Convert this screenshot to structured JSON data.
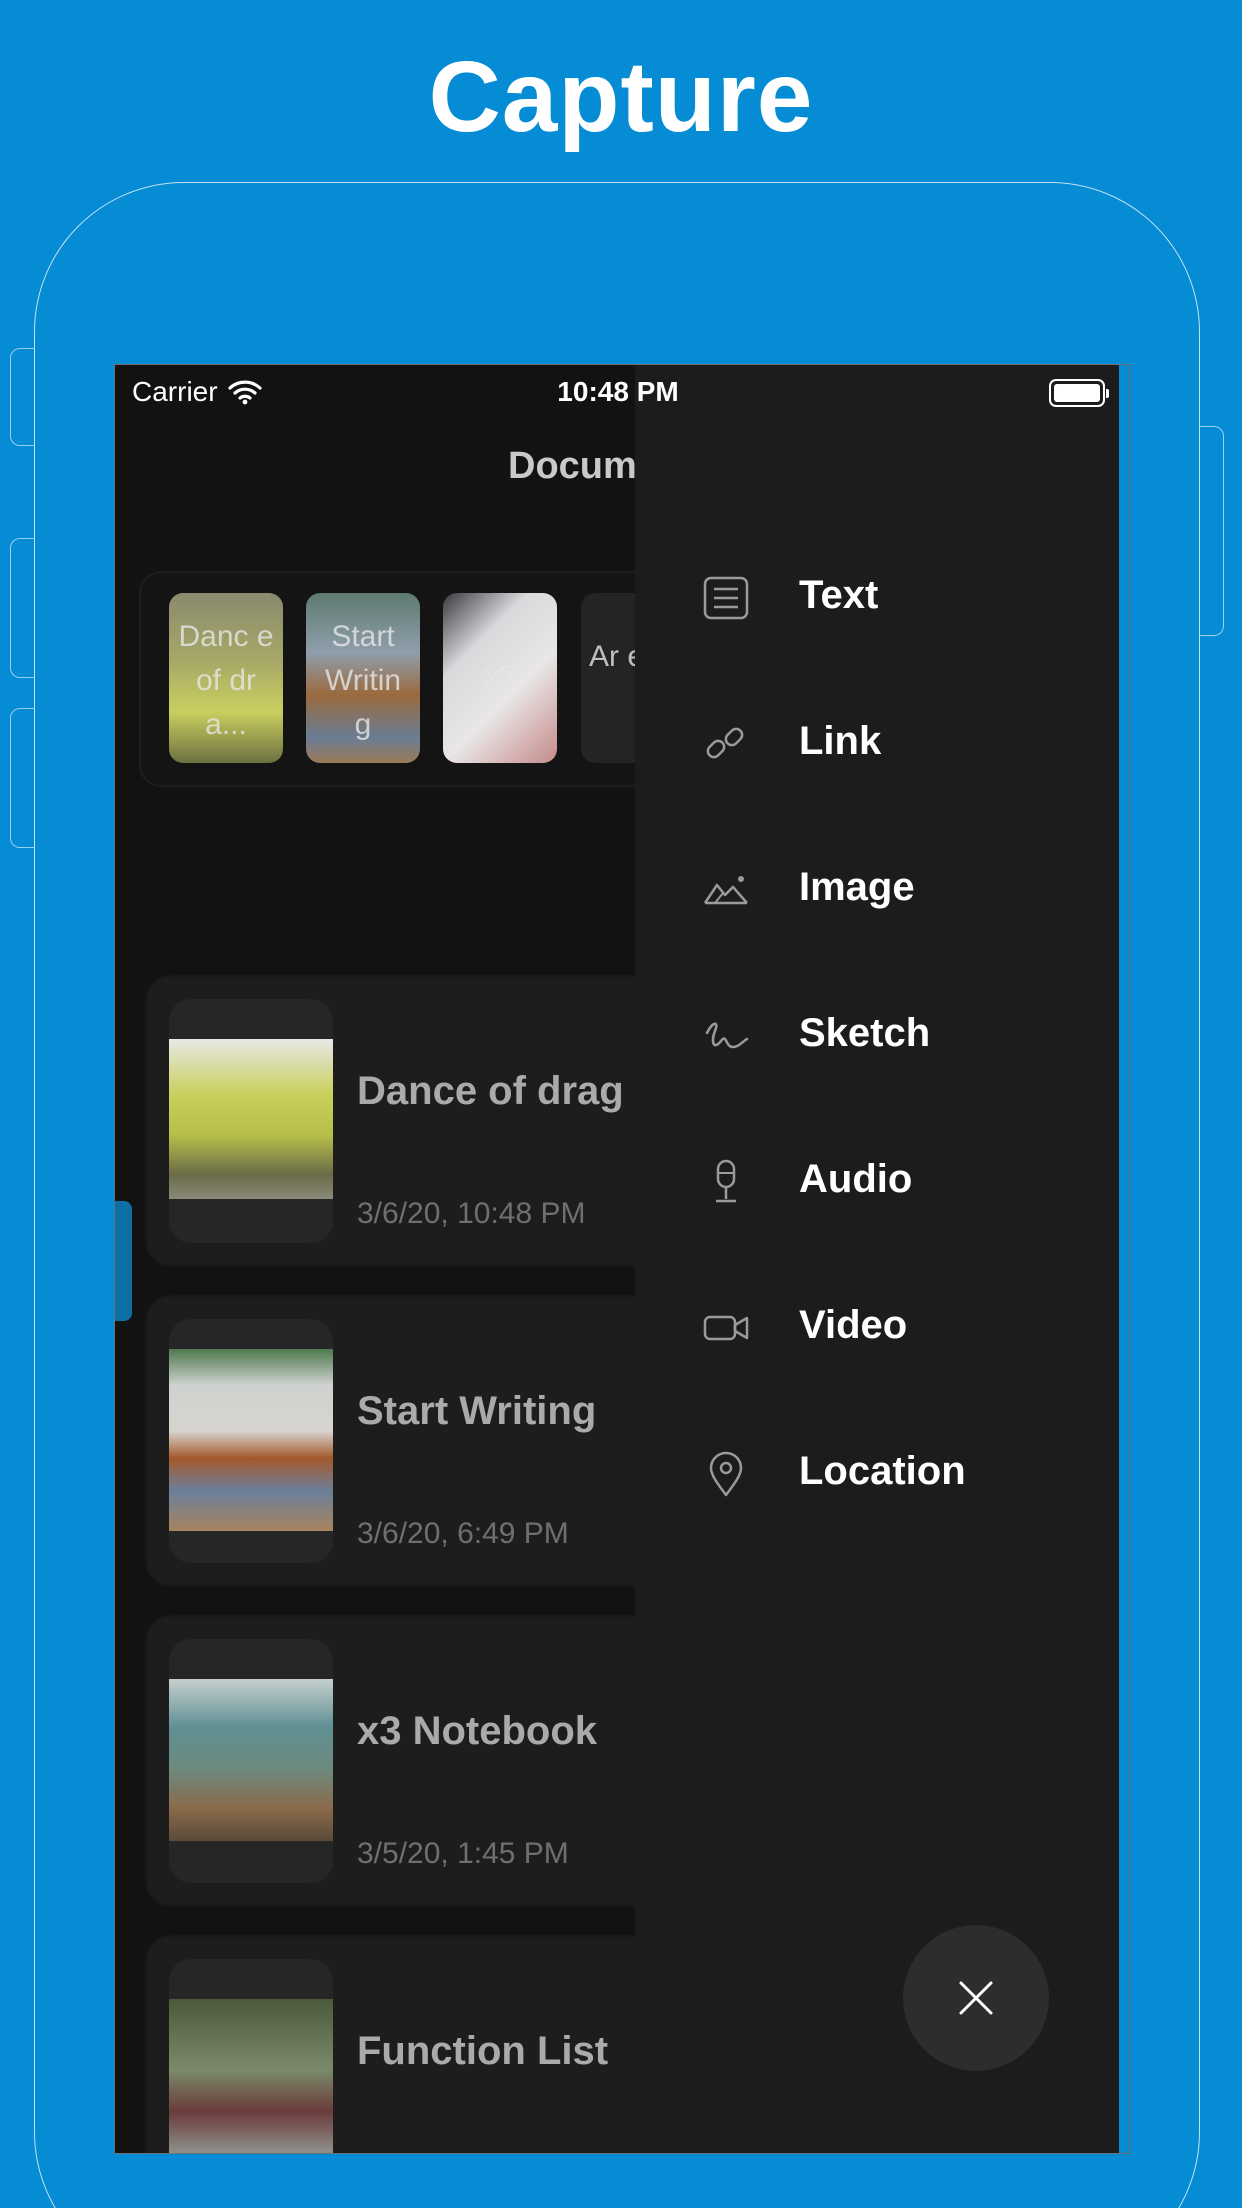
{
  "headline": "Capture",
  "status_bar": {
    "carrier": "Carrier",
    "time": "10:48 PM"
  },
  "header": {
    "title": "Docum"
  },
  "recent": [
    {
      "label": "Danc e of dra..."
    },
    {
      "label": "Start Writin g"
    },
    {
      "label": "x3"
    },
    {
      "label": "Ar ev"
    }
  ],
  "documents": [
    {
      "name": "Dance of drag",
      "date": "3/6/20, 10:48 PM"
    },
    {
      "name": "Start Writing",
      "date": "3/6/20, 6:49 PM"
    },
    {
      "name": "x3 Notebook",
      "date": "3/5/20, 1:45 PM"
    },
    {
      "name": "Function List",
      "date": ""
    }
  ],
  "capture_menu": [
    {
      "label": "Text",
      "icon": "text-icon"
    },
    {
      "label": "Link",
      "icon": "link-icon"
    },
    {
      "label": "Image",
      "icon": "image-icon"
    },
    {
      "label": "Sketch",
      "icon": "sketch-icon"
    },
    {
      "label": "Audio",
      "icon": "microphone-icon"
    },
    {
      "label": "Video",
      "icon": "video-camera-icon"
    },
    {
      "label": "Location",
      "icon": "location-pin-icon"
    }
  ],
  "colors": {
    "background": "#068bd5",
    "panel": "#1c1c1e",
    "screen": "#121212"
  }
}
